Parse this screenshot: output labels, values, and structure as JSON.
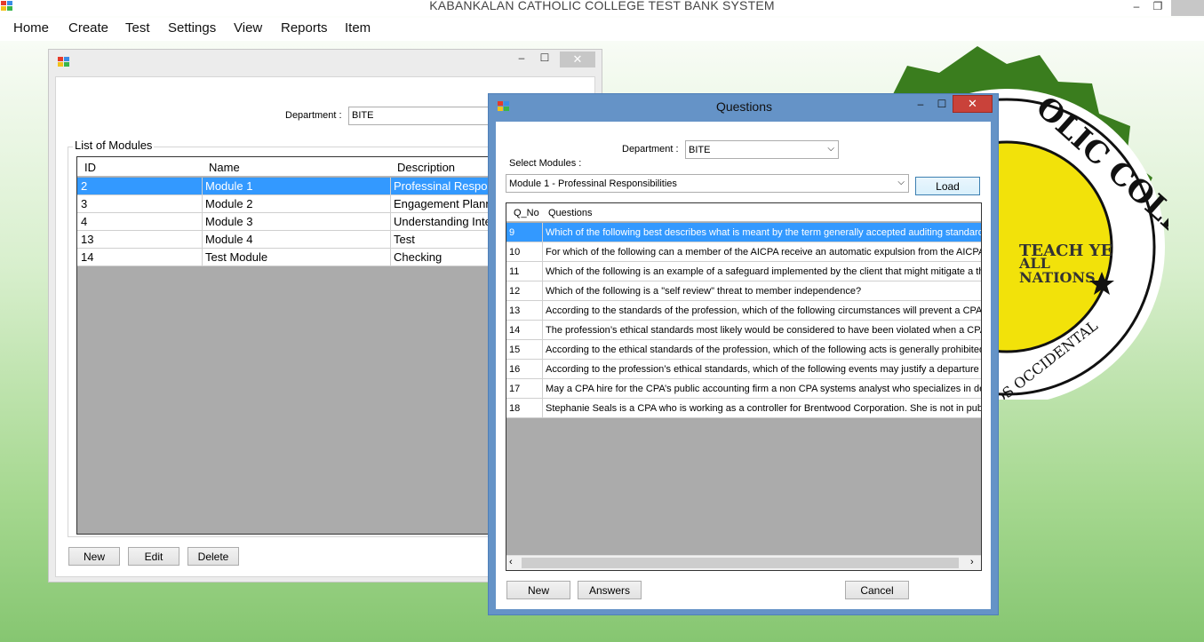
{
  "app": {
    "title": "KABANKALAN CATHOLIC COLLEGE TEST BANK SYSTEM",
    "menu": [
      "Home",
      "Create",
      "Test",
      "Settings",
      "View",
      "Reports",
      "Item"
    ]
  },
  "modules_window": {
    "department_label": "Department :",
    "department_value": "BITE",
    "group_title": "List of Modules",
    "columns": [
      "ID",
      "Name",
      "Description"
    ],
    "rows": [
      [
        "2",
        "Module 1",
        "Professinal Responsibilities"
      ],
      [
        "3",
        "Module 2",
        "Engagement Planning"
      ],
      [
        "4",
        "Module 3",
        "Understanding Internal Control"
      ],
      [
        "13",
        "Module 4",
        "Test"
      ],
      [
        "14",
        "Test Module",
        "Checking"
      ]
    ],
    "buttons": {
      "new": "New",
      "edit": "Edit",
      "delete": "Delete"
    }
  },
  "questions_dialog": {
    "title": "Questions",
    "department_label": "Department :",
    "department_value": "BITE",
    "select_modules_label": "Select Modules :",
    "module_value": "Module 1 - Professinal Responsibilities",
    "load_button": "Load",
    "columns": [
      "Q_No",
      "Questions"
    ],
    "rows": [
      [
        "9",
        "Which of the following best describes what is meant by the term generally accepted auditing standards?"
      ],
      [
        "10",
        "For which of the following can a member of the AICPA receive an automatic expulsion from the AICPA..."
      ],
      [
        "11",
        "Which of the following is an example of a safeguard implemented by the client that might mitigate a thre..."
      ],
      [
        "12",
        "Which of the following is a \"self review\" threat to member independence?"
      ],
      [
        "13",
        "According to the standards of the profession, which of the following circumstances will prevent a CPA ..."
      ],
      [
        "14",
        "The profession’s ethical standards most likely would be considered to have been violated when a CPA..."
      ],
      [
        "15",
        "According to the ethical standards of the profession, which of the following acts is generally prohibited?"
      ],
      [
        "16",
        "According to the profession’s ethical standards, which of the following events may justify a departure fr..."
      ],
      [
        "17",
        "May a CPA hire for the CPA’s public accounting firm a non CPA systems analyst who specializes in dev..."
      ],
      [
        "18",
        "Stephanie Seals is a CPA who is working as a controller for Brentwood Corporation.  She is not in publi..."
      ]
    ],
    "buttons": {
      "new": "New",
      "answers": "Answers",
      "cancel": "Cancel"
    }
  },
  "logo_text": {
    "top": "OLIC COLLEGE",
    "motto1": "TEACH YE",
    "motto2": "ALL",
    "motto3": "NATIONS",
    "bottom": "OS OCCIDENTAL"
  },
  "colors": {
    "selection": "#3399ff",
    "dialog_frame": "#6593c7",
    "close_red": "#c9423a",
    "seal_green": "#3a7d1e",
    "seal_yellow": "#f2e20a"
  }
}
